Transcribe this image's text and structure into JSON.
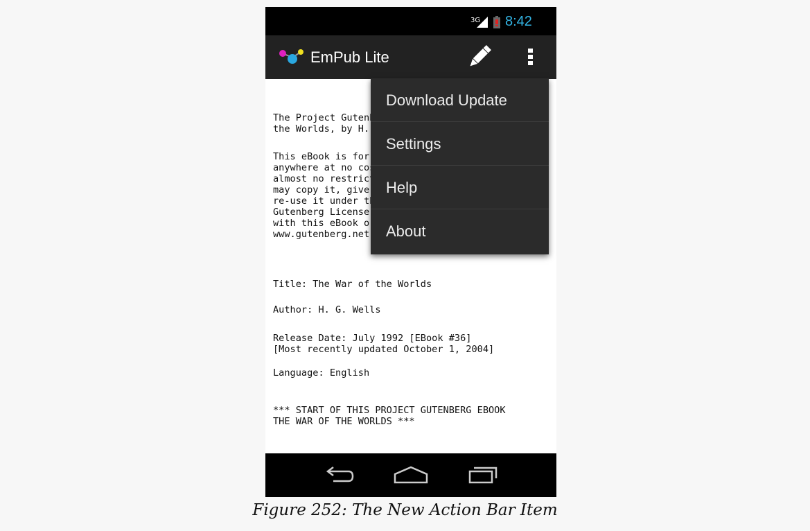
{
  "status_bar": {
    "network_type": "3G",
    "time": "8:42"
  },
  "action_bar": {
    "title": "EmPub Lite",
    "logo_icon": "empub-logo-icon",
    "edit_icon": "pencil-icon",
    "overflow_icon": "overflow-menu-icon"
  },
  "book": {
    "intro": "The Project Gutenberg EBook of The War of\nthe Worlds, by H. G. Wells",
    "license": "This eBook is for the use of anyone\nanywhere at no cost and with\nalmost no restrictions whatsoever. You\nmay copy it, give it away or\nre-use it under the terms of the Project\nGutenberg License included\nwith this eBook or online at\nwww.gutenberg.net",
    "title": "Title: The War of the Worlds",
    "author": "Author: H. G. Wells",
    "release": "Release Date: July 1992 [EBook #36]\n[Most recently updated October 1, 2004]",
    "language": "Language: English",
    "start": "*** START OF THIS PROJECT GUTENBERG EBOOK\nTHE WAR OF THE WORLDS ***"
  },
  "overflow_menu": {
    "items": [
      {
        "label": "Download Update"
      },
      {
        "label": "Settings"
      },
      {
        "label": "Help"
      },
      {
        "label": "About"
      }
    ]
  },
  "nav_bar": {
    "back_icon": "back-icon",
    "home_icon": "home-icon",
    "recents_icon": "recents-icon"
  },
  "caption": "Figure 252: The New Action Bar Item",
  "colors": {
    "accent": "#33b5e5",
    "action_bar": "#222222",
    "menu": "#2b2b2b"
  }
}
